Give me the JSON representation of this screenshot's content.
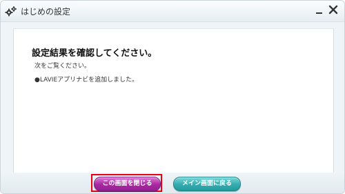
{
  "window": {
    "title": "はじめの設定",
    "icon": "gears-icon",
    "minimize_icon": "minimize-icon",
    "close_icon": "close-icon"
  },
  "content": {
    "heading": "設定結果を確認してください。",
    "subtext": "次をご覧ください。",
    "items": [
      "●LAVIEアプリナビを追加しました。"
    ]
  },
  "footer": {
    "close_label": "この画面を閉じる",
    "main_label": "メイン画面に戻る"
  },
  "colors": {
    "close_button": "#a8279f",
    "main_button": "#33abae",
    "highlight": "#e60012"
  }
}
